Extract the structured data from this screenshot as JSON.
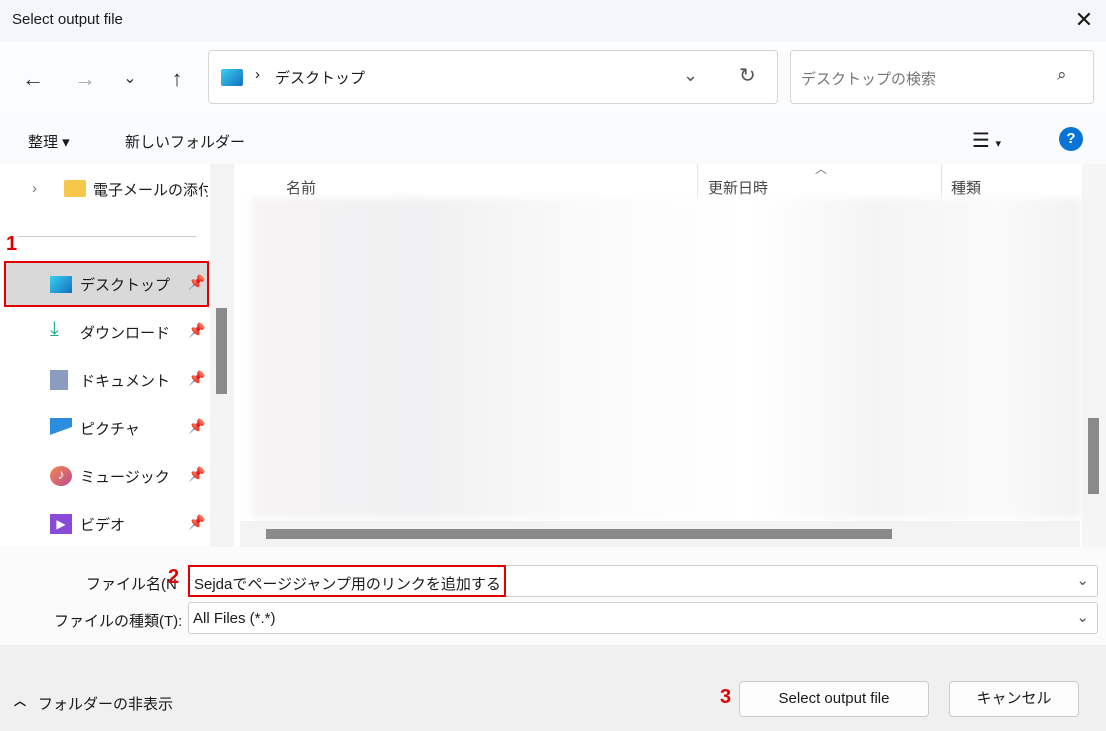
{
  "window": {
    "title": "Select output file"
  },
  "nav": {
    "breadcrumb": "デスクトップ",
    "search_placeholder": "デスクトップの検索"
  },
  "toolbar": {
    "organize": "整理 ▾",
    "new_folder": "新しいフォルダー"
  },
  "sidebar": {
    "top_item": "電子メールの添付",
    "items": [
      {
        "label": "デスクトップ",
        "icon": "desktop-icon"
      },
      {
        "label": "ダウンロード",
        "icon": "download-icon"
      },
      {
        "label": "ドキュメント",
        "icon": "document-icon"
      },
      {
        "label": "ピクチャ",
        "icon": "pictures-icon"
      },
      {
        "label": "ミュージック",
        "icon": "music-icon"
      },
      {
        "label": "ビデオ",
        "icon": "video-icon"
      }
    ]
  },
  "columns": [
    "名前",
    "更新日時",
    "種類"
  ],
  "form": {
    "filename_label": "ファイル名(N",
    "filename_value": "Sejdaでページジャンプ用のリンクを追加する",
    "filetype_label": "ファイルの種類(T):",
    "filetype_value": "All Files (*.*)"
  },
  "footer": {
    "hide_folders": "フォルダーの非表示",
    "select": "Select output file",
    "cancel": "キャンセル"
  },
  "annotations": [
    "1",
    "2",
    "3"
  ],
  "colors": {
    "annotation": "#e00000",
    "help": "#0a74d6"
  }
}
